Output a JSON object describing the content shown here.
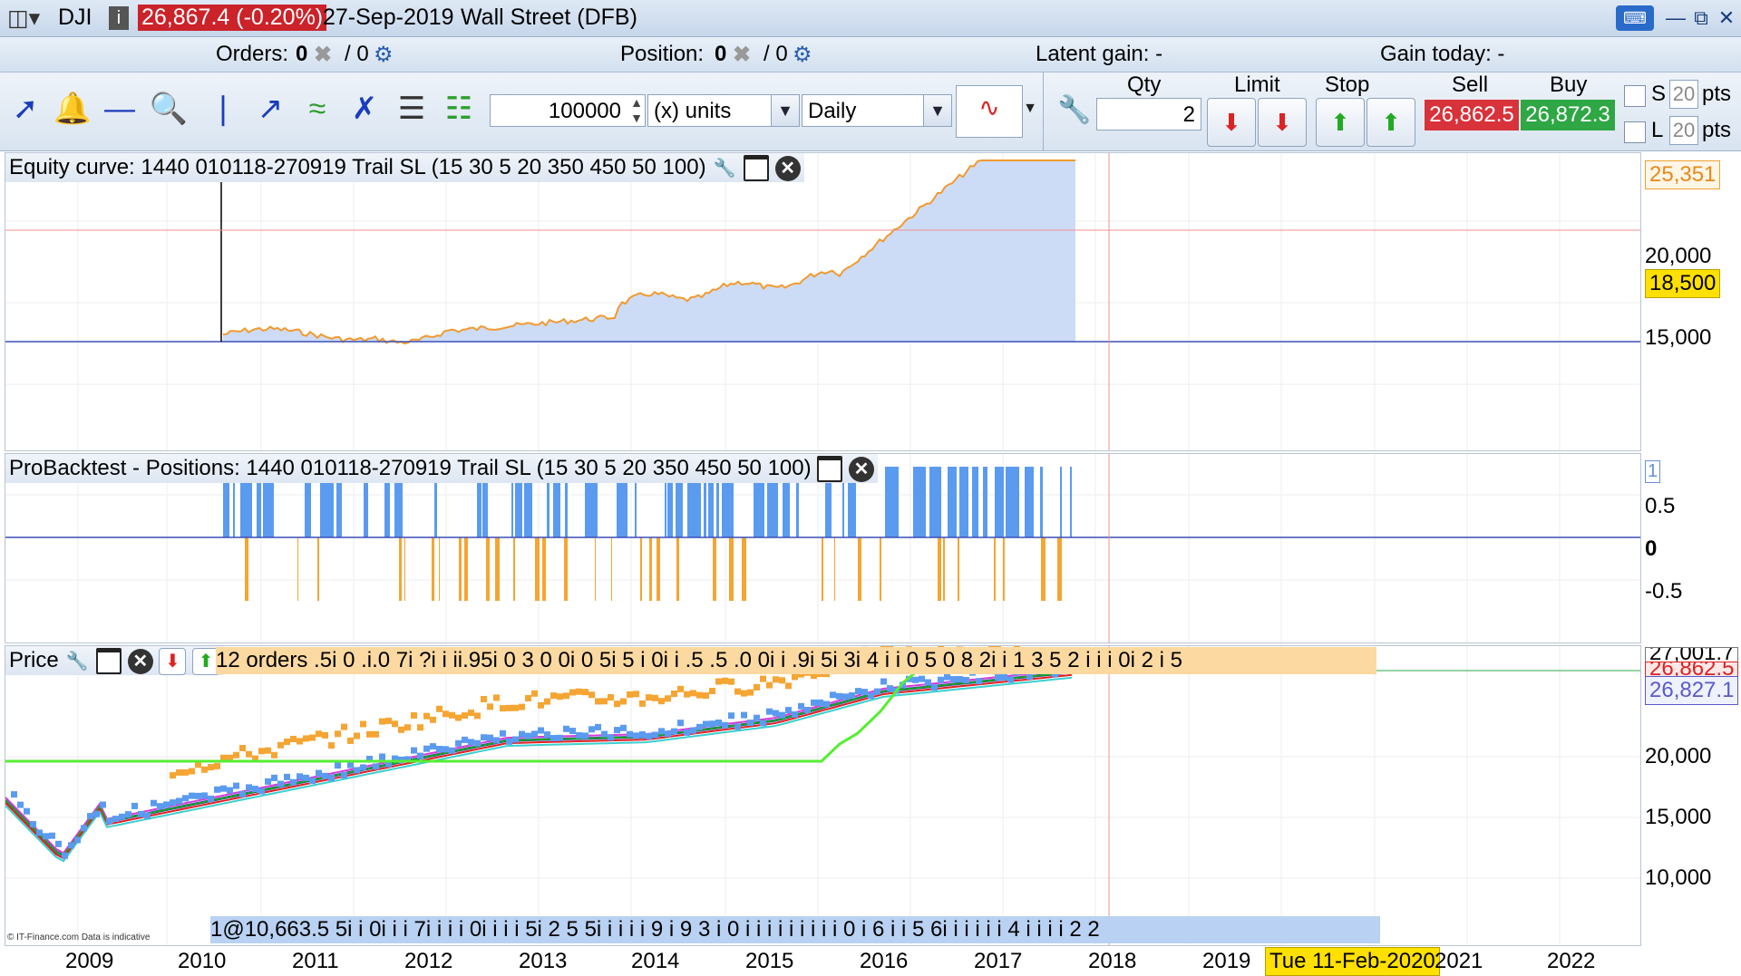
{
  "titlebar": {
    "symbol": "DJI",
    "price_change": "26,867.4 (-0.20%)",
    "date": "27-Sep-2019",
    "instrument": "Wall Street (DFB)"
  },
  "infobar": {
    "orders_label": "Orders:",
    "orders_value": "0",
    "orders_value2": "/ 0",
    "position_label": "Position:",
    "position_value": "0",
    "position_value2": "/ 0",
    "latent_gain": "Latent gain: -",
    "gain_today": "Gain today: -"
  },
  "toolbar": {
    "units_value": "100000",
    "units_label": "(x) units",
    "period": "Daily",
    "qty_label": "Qty",
    "qty_value": "2",
    "limit_label": "Limit",
    "stop_label": "Stop",
    "sell_label": "Sell",
    "sell_price": "26,862.5",
    "buy_label": "Buy",
    "buy_price": "26,872.3",
    "s_label": "S",
    "s_pts_value": "20",
    "s_pts_unit": "pts",
    "l_label": "L",
    "l_pts_value": "20",
    "l_pts_unit": "pts"
  },
  "equity_panel": {
    "title": "Equity curve: 1440 010118-270919 Trail SL (15 30 5 20 350 450 50 100)",
    "axis_labels": [
      "20,000",
      "15,000"
    ],
    "last_tag": "25,351",
    "cursor_tag": "18,500"
  },
  "positions_panel": {
    "title": "ProBacktest - Positions: 1440 010118-270919 Trail SL (15 30 5 20 350 450 50 100)",
    "axis_labels": [
      "1",
      "0.5",
      "0",
      "-0.5"
    ]
  },
  "price_panel": {
    "title": "Price",
    "orders_text": "12 orders .5і 0 .і.0 7і ?і і іі.95і 0 3 0 0і 0 5і 5 і 0і і .5 .5 .0 0і і .9і 5і 3і 4 і і 0 5 0 8 2і і 1 3 5 2 і і і 0і 2 і 5",
    "bottom_orders_text": "1@10,663.5 5і і 0і і і 7і і і і 0і і і і 5і 2 5 5і і і і і 9 і 9 3 і 0 і і і і і і і і і 0 і 6 і і 5 6і і і і і і 4 і і і і 2 2",
    "axis_labels": [
      "20,000",
      "15,000",
      "10,000"
    ],
    "tag_top": "27,001.7",
    "tag_sell": "26,862.5",
    "tag_last": "26,827.1",
    "credit": "© IT-Finance.com  Data is indicative"
  },
  "xaxis": {
    "years": [
      "2009",
      "2010",
      "2011",
      "2012",
      "2013",
      "2014",
      "2015",
      "2016",
      "2017",
      "2018",
      "2019",
      "2021",
      "2022"
    ],
    "cursor_date": "Tue 11-Feb-2020"
  },
  "colors": {
    "equity_fill": "#cddcf6",
    "equity_line": "#f29a2e",
    "long_bars": "#5b9bef",
    "short_bars": "#f5a533",
    "stop_line": "#55ee33",
    "sell_red": "#d8323a",
    "buy_green": "#2ea744"
  }
}
